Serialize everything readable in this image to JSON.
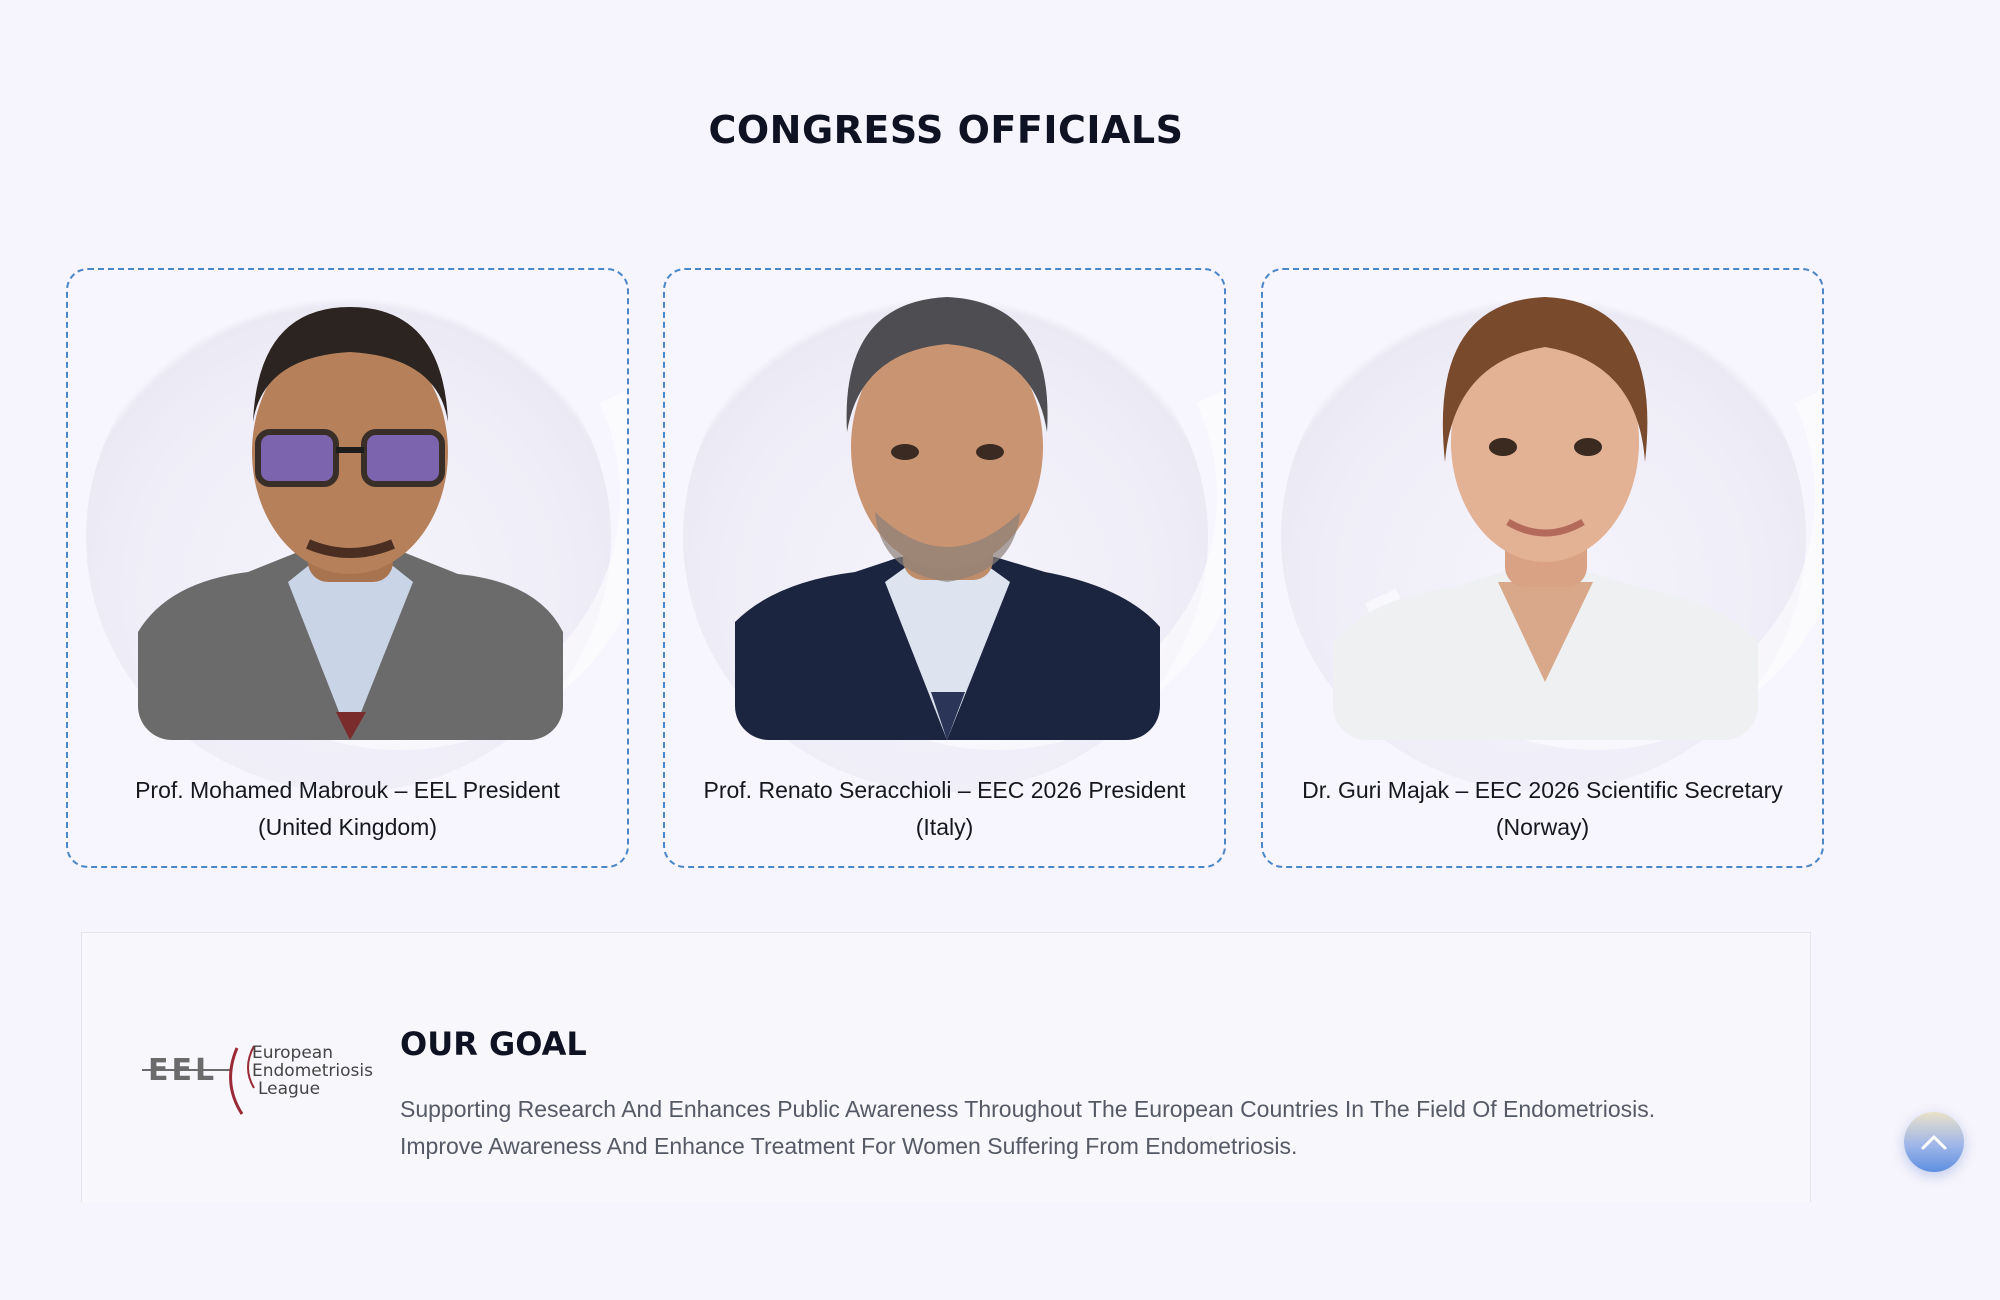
{
  "section": {
    "title": "CONGRESS OFFICIALS"
  },
  "officials": [
    {
      "name_line1": "Prof. Mohamed Mabrouk – EEL President",
      "name_line2": "(United Kingdom)"
    },
    {
      "name_line1": "Prof. Renato Seracchioli – EEC 2026 President",
      "name_line2": "(Italy)"
    },
    {
      "name_line1": "Dr. Guri Majak – EEC 2026 Scientific Secretary",
      "name_line2": "(Norway)"
    }
  ],
  "goal": {
    "logo_letters": "EEL",
    "logo_line1": "European",
    "logo_line2": "Endometriosis",
    "logo_line3": "League",
    "title": "OUR GOAL",
    "line1": "Supporting Research And Enhances Public Awareness Throughout The European Countries In The Field Of Endometriosis.",
    "line2": "Improve Awareness And Enhance Treatment For Women Suffering From Endometriosis."
  },
  "colors": {
    "card_border": "#4a86c8",
    "background": "#f6f4fc",
    "scroll_button": "#5d8fe0"
  },
  "icons": {
    "scroll_top": "chevron-up-icon"
  }
}
